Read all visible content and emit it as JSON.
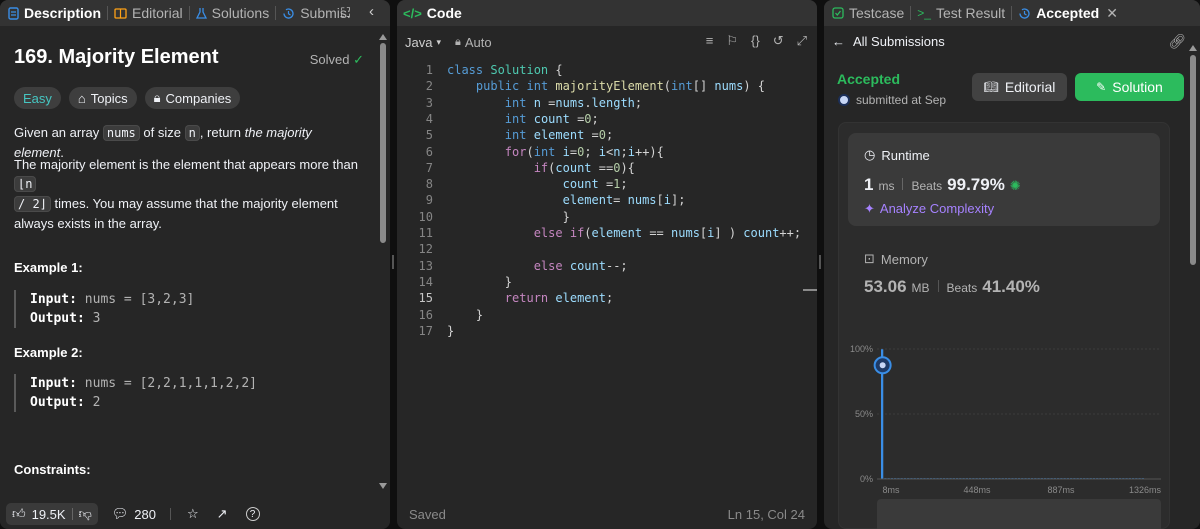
{
  "left": {
    "tabs": [
      {
        "label": "Description",
        "icon": "document-icon"
      },
      {
        "label": "Editorial",
        "icon": "book-icon"
      },
      {
        "label": "Solutions",
        "icon": "flask-icon"
      },
      {
        "label": "Submis:",
        "icon": "history-icon"
      }
    ],
    "title": "169. Majority Element",
    "solved": "Solved",
    "chips": {
      "easy": "Easy",
      "topics": "Topics",
      "companies": "Companies"
    },
    "para1": {
      "pre": "Given an array ",
      "code1": "nums",
      "mid": " of size ",
      "code2": "n",
      "post": ", return ",
      "em": "the majority element",
      "end": "."
    },
    "para2": {
      "pre": "The majority element is the element that appears more than ",
      "code1": "⌊n",
      "code2": "/ 2⌋",
      "post": " times. You may assume that the majority element always exists in the array."
    },
    "examples": [
      {
        "heading": "Example 1:",
        "input_label": "Input:",
        "input": " nums = [3,2,3]",
        "output_label": "Output:",
        "output": " 3"
      },
      {
        "heading": "Example 2:",
        "input_label": "Input:",
        "input": " nums = [2,2,1,1,1,2,2]",
        "output_label": "Output:",
        "output": " 2"
      }
    ],
    "constraints": "Constraints:",
    "likes": "19.5K",
    "comments": "280"
  },
  "middle": {
    "tab": "Code",
    "language": "Java",
    "auto": "Auto",
    "line_numbers": [
      "1",
      "2",
      "3",
      "4",
      "5",
      "6",
      "7",
      "8",
      "9",
      "10",
      "11",
      "12",
      "13",
      "14",
      "15",
      "16",
      "17"
    ],
    "code_lines": [
      "class Solution {",
      "    public int majorityElement(int[] nums) {",
      "        int n =nums.length;",
      "        int count =0;",
      "        int element =0;",
      "        for(int i=0; i<n;i++){",
      "            if(count ==0){",
      "                count =1;",
      "                element= nums[i];",
      "                }",
      "            else if(element == nums[i] ) count++;",
      "",
      "            else count--;",
      "        }",
      "        return element;",
      "    }",
      "}"
    ],
    "current_line": 15,
    "status_left": "Saved",
    "status_right": "Ln 15, Col 24"
  },
  "right": {
    "tabs": [
      {
        "label": "Testcase",
        "icon": "check-square-icon"
      },
      {
        "label": "Test Result",
        "icon": "terminal-icon"
      },
      {
        "label": "Accepted",
        "icon": "history-icon"
      }
    ],
    "back": "All Submissions",
    "accepted": "Accepted",
    "submitted": "submitted at Sep",
    "editorial_btn": "Editorial",
    "solution_btn": "Solution",
    "runtime": {
      "label": "Runtime",
      "value": "1",
      "unit": "ms",
      "beats_label": "Beats",
      "beats": "99.79%",
      "analyze": "Analyze Complexity"
    },
    "memory": {
      "label": "Memory",
      "value": "53.06",
      "unit": "MB",
      "beats_label": "Beats",
      "beats": "41.40%"
    },
    "chart_data": {
      "type": "bar",
      "x_ticks": [
        "8ms",
        "448ms",
        "887ms",
        "1326ms"
      ],
      "y_ticks": [
        "100%",
        "50%",
        "0%"
      ],
      "ylim": [
        0,
        100
      ],
      "values": [
        99.79,
        0.6,
        0.6,
        0.6,
        0.6,
        0.6,
        0.6,
        0.6,
        0.6,
        0.6,
        0.6,
        0.6,
        0.6,
        0.6,
        0.6,
        0.6,
        0.6,
        0.6,
        0.6,
        0.6,
        0.6,
        0.6,
        0.6,
        0.6,
        0.6,
        0.6,
        0.6,
        0.6,
        0.6,
        0.6,
        0.6,
        0.6,
        0.6,
        0.6,
        0.6,
        0.6,
        0.6,
        0.6,
        0.6,
        0.6,
        0.6,
        0.6,
        0.6,
        0.6,
        0.6,
        0.6,
        0.6,
        0.6,
        0.6,
        0.6,
        0.6,
        0.6,
        0.6,
        0.6,
        0.6,
        0.6,
        0.6,
        0.6,
        0.6,
        0.6,
        0.6,
        0.6,
        0.6,
        0.6,
        0.6,
        0.6,
        0.6,
        0.6,
        0.6,
        0.6,
        0.6,
        0.6,
        0.6,
        0.6,
        0.6,
        0.6,
        0.6,
        0.6,
        0.6,
        0.6,
        0.6
      ],
      "highlight_index": 0,
      "color": "#3a8ee6"
    }
  }
}
